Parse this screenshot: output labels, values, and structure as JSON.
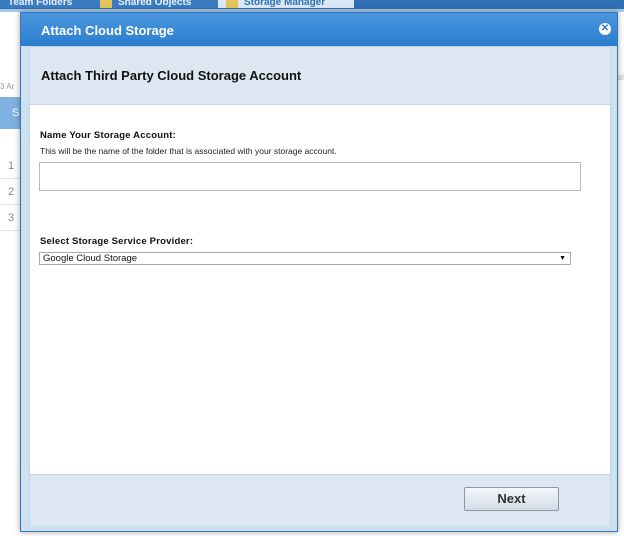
{
  "background": {
    "tabs": [
      "Team Folders",
      "Shared Objects",
      "Storage Manager"
    ],
    "subtext": "3 Ar",
    "header_letter": "S",
    "row_numbers": [
      "1",
      "2",
      "3"
    ],
    "right_text": "al"
  },
  "dialog": {
    "title": "Attach Cloud Storage",
    "close_glyph": "✕",
    "heading": "Attach Third Party Cloud Storage Account",
    "name_label": "Name Your Storage Account:",
    "name_help": "This will be the name of the folder that is associated with your storage account.",
    "name_value": "",
    "provider_label": "Select Storage Service Provider:",
    "provider_selected": "Google Cloud Storage",
    "next_label": "Next"
  },
  "colors": {
    "titlebar": "#2b7dcd",
    "panel_header": "#dce7f1"
  }
}
